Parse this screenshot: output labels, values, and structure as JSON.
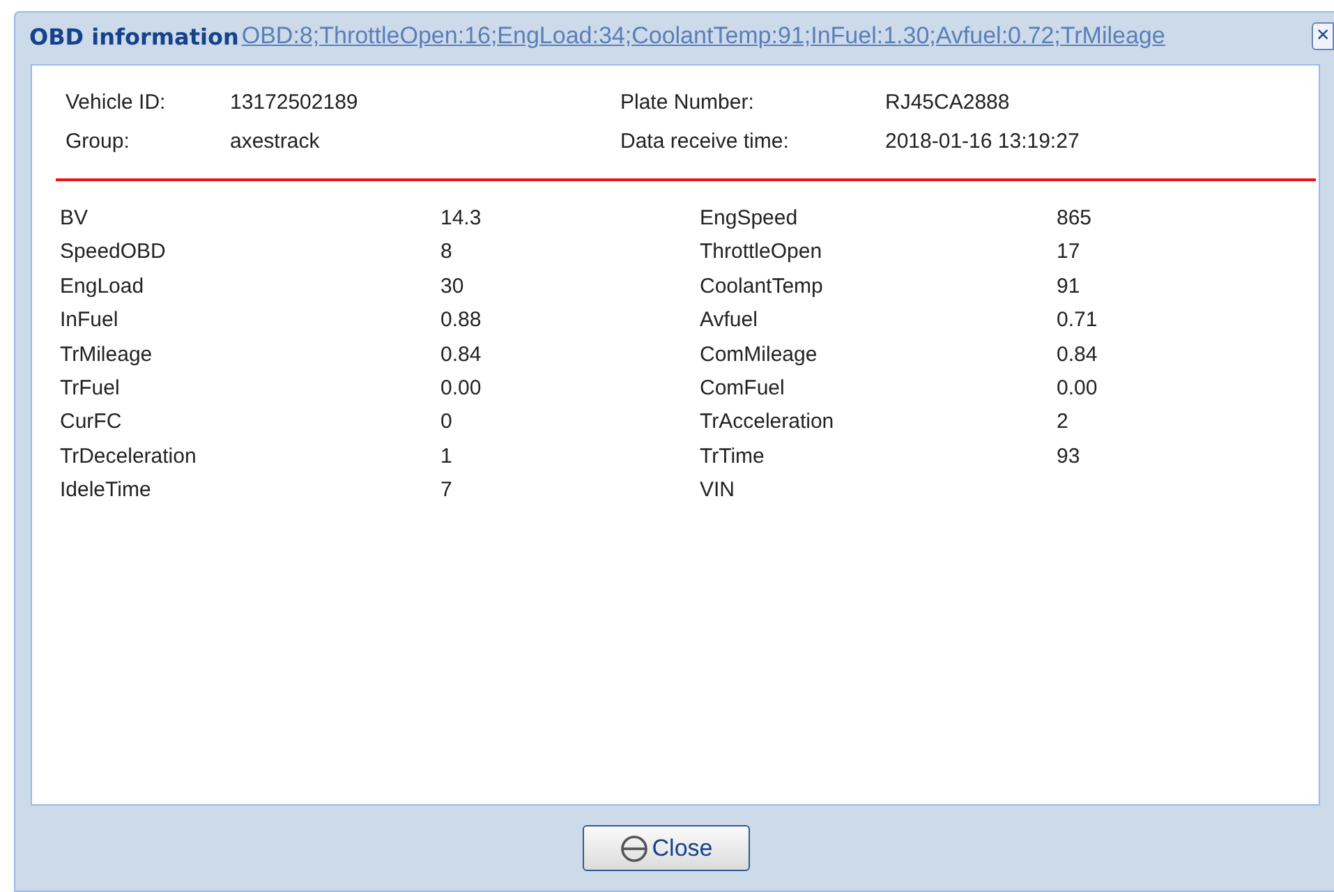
{
  "window": {
    "title": "OBD information",
    "background_text": "OBD:8;ThrottleOpen:16;EngLoad:34;CoolantTemp:91;InFuel:1.30;Avfuel:0.72;TrMileage",
    "close_glyph": "×"
  },
  "info": [
    {
      "label": "Vehicle ID:",
      "value": "13172502189"
    },
    {
      "label": "Plate Number:",
      "value": "RJ45CA2888"
    },
    {
      "label": "Group:",
      "value": "axestrack"
    },
    {
      "label": "Data receive time:",
      "value": "2018-01-16 13:19:27"
    }
  ],
  "readings": [
    {
      "name": "BV",
      "value": "14.3"
    },
    {
      "name": "EngSpeed",
      "value": "865"
    },
    {
      "name": "SpeedOBD",
      "value": "8"
    },
    {
      "name": "ThrottleOpen",
      "value": "17"
    },
    {
      "name": "EngLoad",
      "value": "30"
    },
    {
      "name": "CoolantTemp",
      "value": "91"
    },
    {
      "name": "InFuel",
      "value": "0.88"
    },
    {
      "name": "Avfuel",
      "value": "0.71"
    },
    {
      "name": "TrMileage",
      "value": "0.84"
    },
    {
      "name": "ComMileage",
      "value": "0.84"
    },
    {
      "name": "TrFuel",
      "value": "0.00"
    },
    {
      "name": "ComFuel",
      "value": "0.00"
    },
    {
      "name": "CurFC",
      "value": "0"
    },
    {
      "name": "TrAcceleration",
      "value": "2"
    },
    {
      "name": "TrDeceleration",
      "value": "1"
    },
    {
      "name": "TrTime",
      "value": "93"
    },
    {
      "name": "IdeleTime",
      "value": "7"
    },
    {
      "name": "VIN"
    }
  ],
  "buttons": [
    {
      "label": "Close"
    }
  ]
}
